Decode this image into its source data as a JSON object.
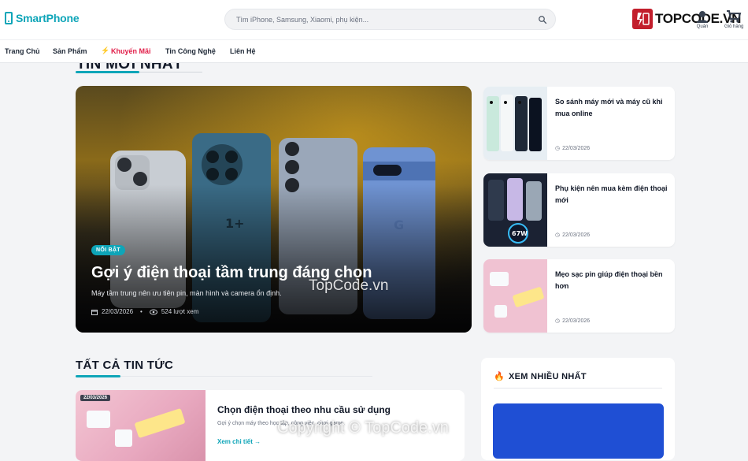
{
  "header": {
    "logo_text": "SmartPhone",
    "search_placeholder": "Tìm iPhone, Samsung, Xiaomi, phụ kiện...",
    "user_label": "Quản",
    "cart_label": "Giỏ hàng",
    "brand_watermark": "TOPCODE.VN"
  },
  "nav": {
    "items": [
      "Trang Chủ",
      "Sản Phẩm",
      "Khuyến Mãi",
      "Tin Công Nghệ",
      "Liên Hệ"
    ]
  },
  "latest": {
    "title": "TIN MỚI NHẤT",
    "hero": {
      "badge": "NỔI BẬT",
      "title": "Gợi ý điện thoại tầm trung đáng chọn",
      "subtitle": "Máy tầm trung nên ưu tiên pin, màn hình và camera ổn định.",
      "date": "22/03/2026",
      "views": "524 lượt xem"
    },
    "side": [
      {
        "title": "So sánh máy mới và máy cũ khi mua online",
        "date": "22/03/2026"
      },
      {
        "title": "Phụ kiện nên mua kèm điện thoại mới",
        "date": "22/03/2026"
      },
      {
        "title": "Mẹo sạc pin giúp điện thoại bền hơn",
        "date": "22/03/2026"
      }
    ]
  },
  "all_news": {
    "title": "TẤT CẢ TIN TỨC",
    "items": [
      {
        "date": "22/03/2026",
        "title": "Chọn điện thoại theo nhu cầu sử dụng",
        "subtitle": "Gợi ý chọn máy theo học tập, công việc, chơi game.",
        "more": "Xem chi tiết"
      }
    ]
  },
  "popular": {
    "title": "XEM NHIỀU NHẤT"
  },
  "watermarks": {
    "center": "TopCode.vn",
    "bottom": "Copyright © TopCode.vn"
  },
  "colors": {
    "accent": "#0ea5b8",
    "promo": "#e11d48",
    "brand_red": "#c21e2c"
  }
}
